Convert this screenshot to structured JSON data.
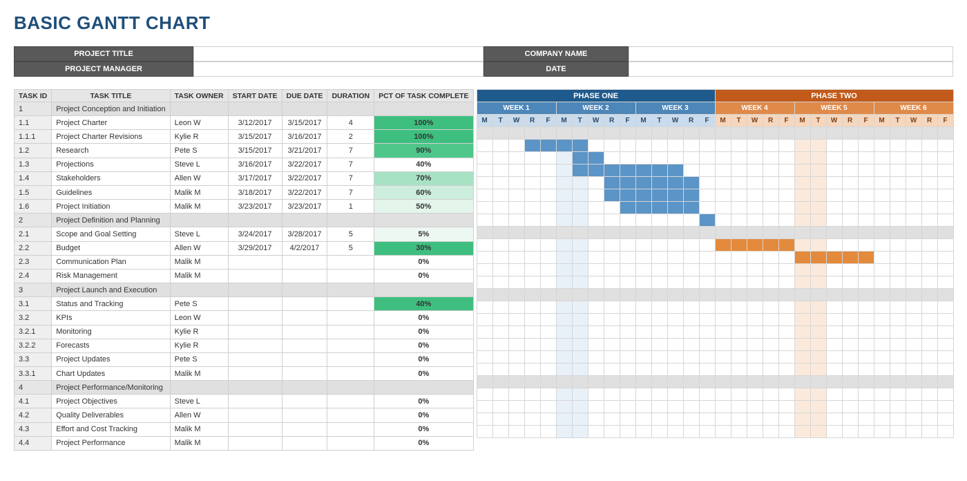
{
  "title": "BASIC GANTT CHART",
  "meta": {
    "labels": [
      "PROJECT TITLE",
      "COMPANY NAME",
      "PROJECT MANAGER",
      "DATE"
    ],
    "values": [
      "",
      "",
      "",
      ""
    ]
  },
  "columns": {
    "id": "TASK ID",
    "title": "TASK TITLE",
    "owner": "TASK OWNER",
    "start": "START DATE",
    "due": "DUE DATE",
    "dur": "DURATION",
    "pct": "PCT OF TASK COMPLETE"
  },
  "phases": [
    {
      "name": "PHASE ONE",
      "weeks": [
        "WEEK 1",
        "WEEK 2",
        "WEEK 3"
      ],
      "weekClass": "w-blue",
      "dayClass": "d-blue",
      "phaseClass": "p1"
    },
    {
      "name": "PHASE TWO",
      "weeks": [
        "WEEK 4",
        "WEEK 5",
        "WEEK 6"
      ],
      "weekClass": "w-orange",
      "dayClass": "d-orange",
      "phaseClass": "p2"
    }
  ],
  "dayLabels": [
    "M",
    "T",
    "W",
    "R",
    "F"
  ],
  "tasks": [
    {
      "id": "1",
      "title": "Project Conception and Initiation",
      "owner": "",
      "start": "",
      "due": "",
      "dur": "",
      "pct": "",
      "pctBg": "",
      "section": true,
      "bar": null
    },
    {
      "id": "1.1",
      "title": "Project Charter",
      "owner": "Leon W",
      "start": "3/12/2017",
      "due": "3/15/2017",
      "dur": "4",
      "pct": "100%",
      "pctBg": "#3fbf7f",
      "bar": [
        4,
        7,
        "blue"
      ]
    },
    {
      "id": "1.1.1",
      "title": "Project Charter Revisions",
      "owner": "Kylie R",
      "start": "3/15/2017",
      "due": "3/16/2017",
      "dur": "2",
      "pct": "100%",
      "pctBg": "#3fbf7f",
      "bar": [
        7,
        8,
        "blue"
      ]
    },
    {
      "id": "1.2",
      "title": "Research",
      "owner": "Pete S",
      "start": "3/15/2017",
      "due": "3/21/2017",
      "dur": "7",
      "pct": "90%",
      "pctBg": "#4fc78b",
      "bar": [
        7,
        13,
        "blue"
      ]
    },
    {
      "id": "1.3",
      "title": "Projections",
      "owner": "Steve L",
      "start": "3/16/2017",
      "due": "3/22/2017",
      "dur": "7",
      "pct": "40%",
      "pctBg": "",
      "bar": [
        9,
        14,
        "blue"
      ]
    },
    {
      "id": "1.4",
      "title": "Stakeholders",
      "owner": "Allen W",
      "start": "3/17/2017",
      "due": "3/22/2017",
      "dur": "7",
      "pct": "70%",
      "pctBg": "#a8e2c5",
      "bar": [
        9,
        14,
        "blue"
      ]
    },
    {
      "id": "1.5",
      "title": "Guidelines",
      "owner": "Malik M",
      "start": "3/18/2017",
      "due": "3/22/2017",
      "dur": "7",
      "pct": "60%",
      "pctBg": "#cdeedd",
      "bar": [
        10,
        14,
        "blue"
      ]
    },
    {
      "id": "1.6",
      "title": "Project Initiation",
      "owner": "Malik M",
      "start": "3/23/2017",
      "due": "3/23/2017",
      "dur": "1",
      "pct": "50%",
      "pctBg": "#e4f5ec",
      "bar": [
        15,
        15,
        "blue"
      ]
    },
    {
      "id": "2",
      "title": "Project Definition and Planning",
      "owner": "",
      "start": "",
      "due": "",
      "dur": "",
      "pct": "",
      "pctBg": "",
      "section": true,
      "bar": null
    },
    {
      "id": "2.1",
      "title": "Scope and Goal Setting",
      "owner": "Steve L",
      "start": "3/24/2017",
      "due": "3/28/2017",
      "dur": "5",
      "pct": "5%",
      "pctBg": "#edf8f2",
      "bar": [
        16,
        20,
        "orange"
      ]
    },
    {
      "id": "2.2",
      "title": "Budget",
      "owner": "Allen W",
      "start": "3/29/2017",
      "due": "4/2/2017",
      "dur": "5",
      "pct": "30%",
      "pctBg": "#3fbf7f",
      "bar": [
        21,
        25,
        "orange"
      ]
    },
    {
      "id": "2.3",
      "title": "Communication Plan",
      "owner": "Malik M",
      "start": "",
      "due": "",
      "dur": "",
      "pct": "0%",
      "pctBg": "",
      "bar": null
    },
    {
      "id": "2.4",
      "title": "Risk Management",
      "owner": "Malik M",
      "start": "",
      "due": "",
      "dur": "",
      "pct": "0%",
      "pctBg": "",
      "bar": null
    },
    {
      "id": "3",
      "title": "Project Launch and Execution",
      "owner": "",
      "start": "",
      "due": "",
      "dur": "",
      "pct": "",
      "pctBg": "",
      "section": true,
      "bar": null
    },
    {
      "id": "3.1",
      "title": "Status and Tracking",
      "owner": "Pete S",
      "start": "",
      "due": "",
      "dur": "",
      "pct": "40%",
      "pctBg": "#3fbf7f",
      "bar": null
    },
    {
      "id": "3.2",
      "title": "KPIs",
      "owner": "Leon W",
      "start": "",
      "due": "",
      "dur": "",
      "pct": "0%",
      "pctBg": "",
      "bar": null
    },
    {
      "id": "3.2.1",
      "title": "Monitoring",
      "owner": "Kylie R",
      "start": "",
      "due": "",
      "dur": "",
      "pct": "0%",
      "pctBg": "",
      "bar": null
    },
    {
      "id": "3.2.2",
      "title": "Forecasts",
      "owner": "Kylie R",
      "start": "",
      "due": "",
      "dur": "",
      "pct": "0%",
      "pctBg": "",
      "bar": null
    },
    {
      "id": "3.3",
      "title": "Project Updates",
      "owner": "Pete S",
      "start": "",
      "due": "",
      "dur": "",
      "pct": "0%",
      "pctBg": "",
      "bar": null
    },
    {
      "id": "3.3.1",
      "title": "Chart Updates",
      "owner": "Malik M",
      "start": "",
      "due": "",
      "dur": "",
      "pct": "0%",
      "pctBg": "",
      "bar": null
    },
    {
      "id": "4",
      "title": "Project Performance/Monitoring",
      "owner": "",
      "start": "",
      "due": "",
      "dur": "",
      "pct": "",
      "pctBg": "",
      "section": true,
      "bar": null
    },
    {
      "id": "4.1",
      "title": "Project Objectives",
      "owner": "Steve L",
      "start": "",
      "due": "",
      "dur": "",
      "pct": "0%",
      "pctBg": "",
      "bar": null
    },
    {
      "id": "4.2",
      "title": "Quality Deliverables",
      "owner": "Allen W",
      "start": "",
      "due": "",
      "dur": "",
      "pct": "0%",
      "pctBg": "",
      "bar": null
    },
    {
      "id": "4.3",
      "title": "Effort and Cost Tracking",
      "owner": "Malik M",
      "start": "",
      "due": "",
      "dur": "",
      "pct": "0%",
      "pctBg": "",
      "bar": null
    },
    {
      "id": "4.4",
      "title": "Project Performance",
      "owner": "Malik M",
      "start": "",
      "due": "",
      "dur": "",
      "pct": "0%",
      "pctBg": "",
      "bar": null
    }
  ],
  "shadeColumns": {
    "blue": [
      6,
      7
    ],
    "orange": [
      21,
      22
    ]
  },
  "chart_data": {
    "type": "gantt",
    "title": "BASIC GANTT CHART",
    "phases": [
      {
        "name": "PHASE ONE",
        "weeks": [
          "WEEK 1",
          "WEEK 2",
          "WEEK 3"
        ],
        "day_index_range": [
          1,
          15
        ]
      },
      {
        "name": "PHASE TWO",
        "weeks": [
          "WEEK 4",
          "WEEK 5",
          "WEEK 6"
        ],
        "day_index_range": [
          16,
          30
        ]
      }
    ],
    "days_per_week": [
      "M",
      "T",
      "W",
      "R",
      "F"
    ],
    "tasks": [
      {
        "id": "1",
        "title": "Project Conception and Initiation",
        "section": true
      },
      {
        "id": "1.1",
        "title": "Project Charter",
        "owner": "Leon W",
        "start": "3/12/2017",
        "due": "3/15/2017",
        "duration": 4,
        "pct_complete": 100,
        "bar_days": [
          4,
          7
        ]
      },
      {
        "id": "1.1.1",
        "title": "Project Charter Revisions",
        "owner": "Kylie R",
        "start": "3/15/2017",
        "due": "3/16/2017",
        "duration": 2,
        "pct_complete": 100,
        "bar_days": [
          7,
          8
        ]
      },
      {
        "id": "1.2",
        "title": "Research",
        "owner": "Pete S",
        "start": "3/15/2017",
        "due": "3/21/2017",
        "duration": 7,
        "pct_complete": 90,
        "bar_days": [
          7,
          13
        ]
      },
      {
        "id": "1.3",
        "title": "Projections",
        "owner": "Steve L",
        "start": "3/16/2017",
        "due": "3/22/2017",
        "duration": 7,
        "pct_complete": 40,
        "bar_days": [
          9,
          14
        ]
      },
      {
        "id": "1.4",
        "title": "Stakeholders",
        "owner": "Allen W",
        "start": "3/17/2017",
        "due": "3/22/2017",
        "duration": 7,
        "pct_complete": 70,
        "bar_days": [
          9,
          14
        ]
      },
      {
        "id": "1.5",
        "title": "Guidelines",
        "owner": "Malik M",
        "start": "3/18/2017",
        "due": "3/22/2017",
        "duration": 7,
        "pct_complete": 60,
        "bar_days": [
          10,
          14
        ]
      },
      {
        "id": "1.6",
        "title": "Project Initiation",
        "owner": "Malik M",
        "start": "3/23/2017",
        "due": "3/23/2017",
        "duration": 1,
        "pct_complete": 50,
        "bar_days": [
          15,
          15
        ]
      },
      {
        "id": "2",
        "title": "Project Definition and Planning",
        "section": true
      },
      {
        "id": "2.1",
        "title": "Scope and Goal Setting",
        "owner": "Steve L",
        "start": "3/24/2017",
        "due": "3/28/2017",
        "duration": 5,
        "pct_complete": 5,
        "bar_days": [
          16,
          20
        ]
      },
      {
        "id": "2.2",
        "title": "Budget",
        "owner": "Allen W",
        "start": "3/29/2017",
        "due": "4/2/2017",
        "duration": 5,
        "pct_complete": 30,
        "bar_days": [
          21,
          25
        ]
      },
      {
        "id": "2.3",
        "title": "Communication Plan",
        "owner": "Malik M",
        "pct_complete": 0
      },
      {
        "id": "2.4",
        "title": "Risk Management",
        "owner": "Malik M",
        "pct_complete": 0
      },
      {
        "id": "3",
        "title": "Project Launch and Execution",
        "section": true
      },
      {
        "id": "3.1",
        "title": "Status and Tracking",
        "owner": "Pete S",
        "pct_complete": 40
      },
      {
        "id": "3.2",
        "title": "KPIs",
        "owner": "Leon W",
        "pct_complete": 0
      },
      {
        "id": "3.2.1",
        "title": "Monitoring",
        "owner": "Kylie R",
        "pct_complete": 0
      },
      {
        "id": "3.2.2",
        "title": "Forecasts",
        "owner": "Kylie R",
        "pct_complete": 0
      },
      {
        "id": "3.3",
        "title": "Project Updates",
        "owner": "Pete S",
        "pct_complete": 0
      },
      {
        "id": "3.3.1",
        "title": "Chart Updates",
        "owner": "Malik M",
        "pct_complete": 0
      },
      {
        "id": "4",
        "title": "Project Performance/Monitoring",
        "section": true
      },
      {
        "id": "4.1",
        "title": "Project Objectives",
        "owner": "Steve L",
        "pct_complete": 0
      },
      {
        "id": "4.2",
        "title": "Quality Deliverables",
        "owner": "Allen W",
        "pct_complete": 0
      },
      {
        "id": "4.3",
        "title": "Effort and Cost Tracking",
        "owner": "Malik M",
        "pct_complete": 0
      },
      {
        "id": "4.4",
        "title": "Project Performance",
        "owner": "Malik M",
        "pct_complete": 0
      }
    ]
  }
}
